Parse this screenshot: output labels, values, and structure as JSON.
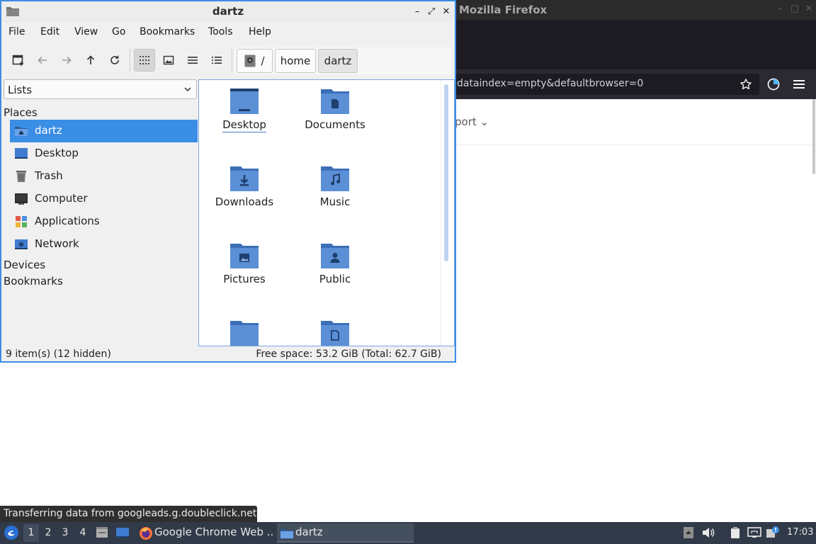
{
  "firefox": {
    "title": "Mozilla Firefox",
    "url": "dataindex=empty&defaultbrowser=0",
    "page_nav_text": "port",
    "minimize": "–",
    "maximize": "□",
    "close": "✕"
  },
  "file_manager": {
    "title": "dartz",
    "window_controls": {
      "minimize": "–",
      "maximize": "⤢",
      "close": "✕"
    },
    "menu": [
      "File",
      "Edit",
      "View",
      "Go",
      "Bookmarks",
      "Tools",
      "Help"
    ],
    "path": {
      "root": "/",
      "home": "home",
      "current": "dartz"
    },
    "side_panel_mode": "Lists",
    "sections": {
      "places": "Places",
      "devices": "Devices",
      "bookmarks": "Bookmarks"
    },
    "places": [
      "dartz",
      "Desktop",
      "Trash",
      "Computer",
      "Applications",
      "Network"
    ],
    "items": [
      "Desktop",
      "Documents",
      "Downloads",
      "Music",
      "Pictures",
      "Public",
      "",
      ""
    ],
    "status_left": "9 item(s) (12 hidden)",
    "status_right": "Free space: 53.2 GiB (Total: 62.7 GiB)"
  },
  "tooltip": "Transferring data from googleads.g.doubleclick.net...",
  "taskbar": {
    "desktops": [
      "1",
      "2",
      "3",
      "4"
    ],
    "tasks": [
      "Google Chrome Web ...",
      "dartz"
    ],
    "clock": "17:03"
  },
  "colors": {
    "accent": "#3b8ee5",
    "folder": "#5b8fd6",
    "folder_dark": "#2d4f80",
    "taskbar": "#313a48"
  }
}
